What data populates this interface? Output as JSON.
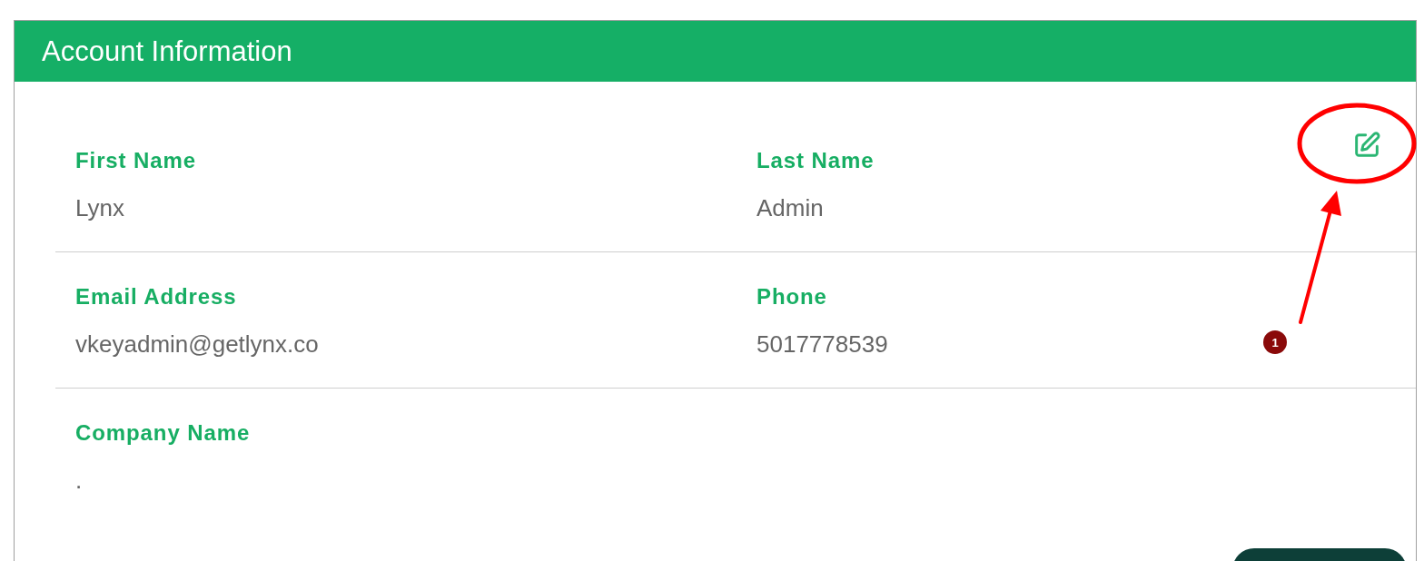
{
  "card": {
    "title": "Account Information",
    "rows": [
      {
        "fields": [
          {
            "label": "First Name",
            "value": "Lynx"
          },
          {
            "label": "Last Name",
            "value": "Admin"
          }
        ]
      },
      {
        "fields": [
          {
            "label": "Email Address",
            "value": "vkeyadmin@getlynx.co"
          },
          {
            "label": "Phone",
            "value": "5017778539"
          }
        ]
      },
      {
        "fields": [
          {
            "label": "Company Name",
            "value": "."
          }
        ]
      }
    ]
  },
  "callout": {
    "number": "1"
  }
}
